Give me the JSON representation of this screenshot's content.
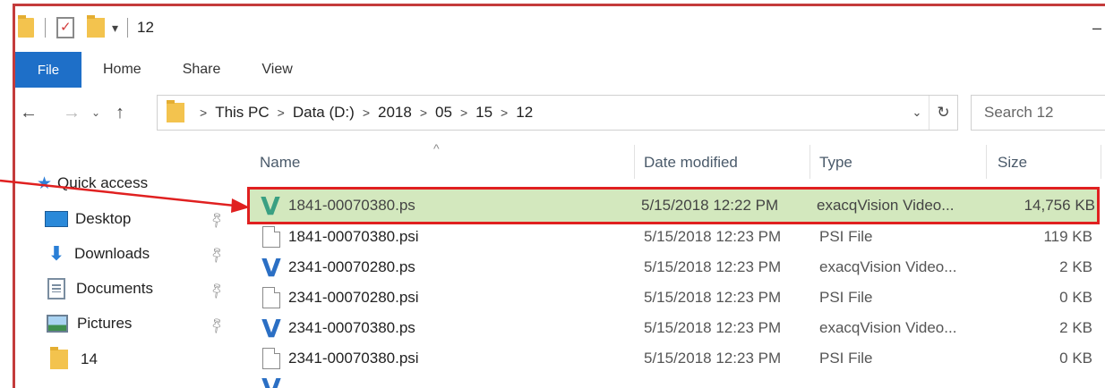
{
  "window": {
    "title": "12",
    "qat_dropdown": "▾"
  },
  "ribbon": {
    "tabs": [
      {
        "label": "File",
        "active": true
      },
      {
        "label": "Home"
      },
      {
        "label": "Share"
      },
      {
        "label": "View"
      }
    ]
  },
  "nav_buttons": {
    "back": "←",
    "forward": "→",
    "recent": "⌄",
    "up": "↑"
  },
  "address": {
    "crumbs": [
      "This PC",
      "Data (D:)",
      "2018",
      "05",
      "15",
      "12"
    ],
    "separator": ">",
    "dropdown": "⌄",
    "refresh": "↻"
  },
  "search": {
    "placeholder": "Search 12"
  },
  "navpane": {
    "items": [
      {
        "label": "Quick access",
        "icon": "star-icon"
      },
      {
        "label": "Desktop",
        "icon": "desktop-icon",
        "pinned": true
      },
      {
        "label": "Downloads",
        "icon": "downloads-icon",
        "pinned": true
      },
      {
        "label": "Documents",
        "icon": "documents-icon",
        "pinned": true
      },
      {
        "label": "Pictures",
        "icon": "pictures-icon",
        "pinned": true
      },
      {
        "label": "14",
        "icon": "folder-icon"
      }
    ]
  },
  "columns": {
    "name": "Name",
    "date": "Date modified",
    "type": "Type",
    "size": "Size"
  },
  "files": [
    {
      "name": "1841-00070380.ps",
      "date": "5/15/2018 12:22 PM",
      "type": "exacqVision Video...",
      "size": "14,756 KB",
      "icon": "exacqvision-icon",
      "selected": true
    },
    {
      "name": "1841-00070380.psi",
      "date": "5/15/2018 12:23 PM",
      "type": "PSI File",
      "size": "119 KB",
      "icon": "file-icon"
    },
    {
      "name": "2341-00070280.ps",
      "date": "5/15/2018 12:23 PM",
      "type": "exacqVision Video...",
      "size": "2 KB",
      "icon": "exacqvision-icon"
    },
    {
      "name": "2341-00070280.psi",
      "date": "5/15/2018 12:23 PM",
      "type": "PSI File",
      "size": "0 KB",
      "icon": "file-icon"
    },
    {
      "name": "2341-00070380.ps",
      "date": "5/15/2018 12:23 PM",
      "type": "exacqVision Video...",
      "size": "2 KB",
      "icon": "exacqvision-icon"
    },
    {
      "name": "2341-00070380.psi",
      "date": "5/15/2018 12:23 PM",
      "type": "PSI File",
      "size": "0 KB",
      "icon": "file-icon"
    }
  ],
  "colors": {
    "accent": "#1e6fc8",
    "selection": "#d3e8be",
    "annotation": "#e02020"
  }
}
